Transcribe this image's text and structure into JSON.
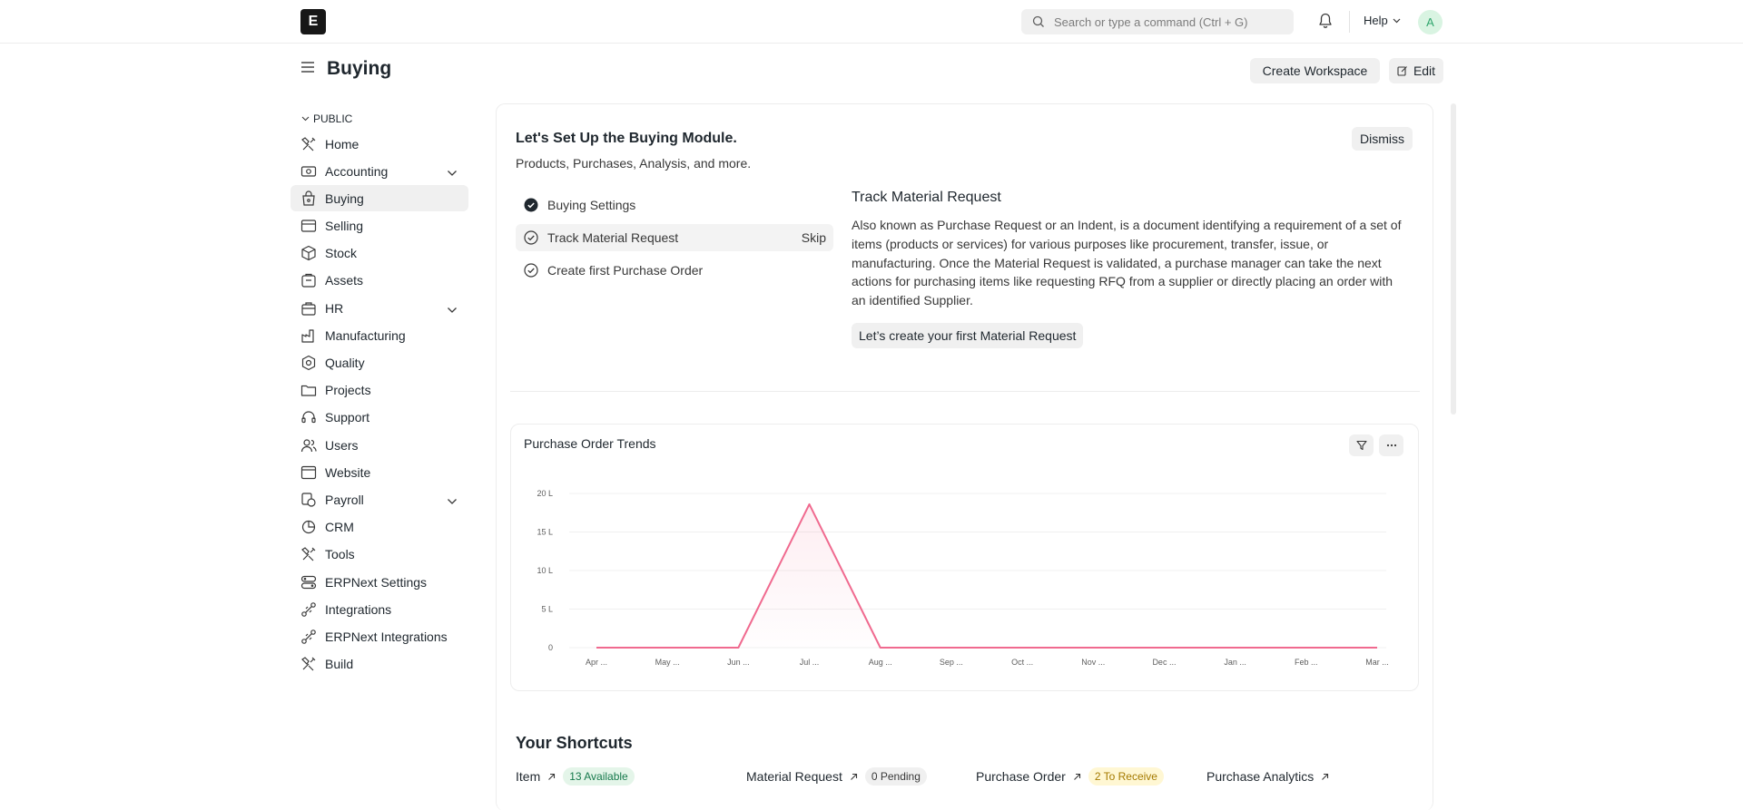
{
  "navbar": {
    "logo_letter": "E",
    "search_placeholder": "Search or type a command (Ctrl + G)",
    "help_label": "Help",
    "avatar_initial": "A"
  },
  "page": {
    "title": "Buying",
    "create_workspace_label": "Create Workspace",
    "edit_label": "Edit"
  },
  "sidebar": {
    "section_label": "PUBLIC",
    "items": [
      {
        "label": "Home",
        "icon": "tools-icon"
      },
      {
        "label": "Accounting",
        "icon": "accounting-icon",
        "expandable": true
      },
      {
        "label": "Buying",
        "icon": "buying-icon",
        "active": true
      },
      {
        "label": "Selling",
        "icon": "selling-icon"
      },
      {
        "label": "Stock",
        "icon": "stock-icon"
      },
      {
        "label": "Assets",
        "icon": "assets-icon"
      },
      {
        "label": "HR",
        "icon": "hr-icon",
        "expandable": true
      },
      {
        "label": "Manufacturing",
        "icon": "manufacturing-icon"
      },
      {
        "label": "Quality",
        "icon": "quality-icon"
      },
      {
        "label": "Projects",
        "icon": "folder-icon"
      },
      {
        "label": "Support",
        "icon": "headset-icon"
      },
      {
        "label": "Users",
        "icon": "users-icon"
      },
      {
        "label": "Website",
        "icon": "website-icon"
      },
      {
        "label": "Payroll",
        "icon": "payroll-icon",
        "expandable": true
      },
      {
        "label": "CRM",
        "icon": "crm-icon"
      },
      {
        "label": "Tools",
        "icon": "tools-icon"
      },
      {
        "label": "ERPNext Settings",
        "icon": "settings-icon"
      },
      {
        "label": "Integrations",
        "icon": "integrations-icon"
      },
      {
        "label": "ERPNext Integrations",
        "icon": "integrations-icon"
      },
      {
        "label": "Build",
        "icon": "tools-icon"
      }
    ]
  },
  "onboarding": {
    "title": "Let's Set Up the Buying Module.",
    "subtitle": "Products, Purchases, Analysis, and more.",
    "dismiss_label": "Dismiss",
    "steps": [
      {
        "label": "Buying Settings",
        "done": true
      },
      {
        "label": "Track Material Request",
        "done": false,
        "skip_label": "Skip"
      },
      {
        "label": "Create first Purchase Order",
        "done": false
      }
    ],
    "detail": {
      "title": "Track Material Request",
      "text": "Also known as Purchase Request or an Indent, is a document identifying a requirement of a set of items (products or services) for various purposes like procurement, transfer, issue, or manufacturing. Once the Material Request is validated, a purchase manager can take the next actions for purchasing items like requesting RFQ from a supplier or directly placing an order with an identified Supplier.",
      "action_label": "Let’s create your first Material Request"
    }
  },
  "chart_data": {
    "type": "line",
    "title": "Purchase Order Trends",
    "categories": [
      "Apr ...",
      "May ...",
      "Jun ...",
      "Jul ...",
      "Aug ...",
      "Sep ...",
      "Oct ...",
      "Nov ...",
      "Dec ...",
      "Jan ...",
      "Feb ...",
      "Mar ..."
    ],
    "series": [
      {
        "values": [
          0,
          0,
          0,
          1860000,
          0,
          0,
          0,
          0,
          0,
          0,
          0,
          0
        ],
        "color": "#f06a8f"
      }
    ],
    "y_ticks": [
      {
        "value": 0,
        "label": "0"
      },
      {
        "value": 500000,
        "label": "5 L"
      },
      {
        "value": 1000000,
        "label": "10 L"
      },
      {
        "value": 1500000,
        "label": "15 L"
      },
      {
        "value": 2000000,
        "label": "20 L"
      }
    ],
    "ylim": [
      0,
      2000000
    ],
    "grid": true,
    "area_fill": true
  },
  "shortcuts": {
    "title": "Your Shortcuts",
    "items": [
      {
        "label": "Item",
        "badge": "13 Available",
        "badge_bg": "#e4f5e9",
        "badge_color": "#16794c"
      },
      {
        "label": "Material Request",
        "badge": "0 Pending",
        "badge_bg": "#f0f0f0",
        "badge_color": "#383838"
      },
      {
        "label": "Purchase Order",
        "badge": "2 To Receive",
        "badge_bg": "#fff7d3",
        "badge_color": "#a57a00"
      },
      {
        "label": "Purchase Analytics",
        "badge": ""
      }
    ]
  }
}
